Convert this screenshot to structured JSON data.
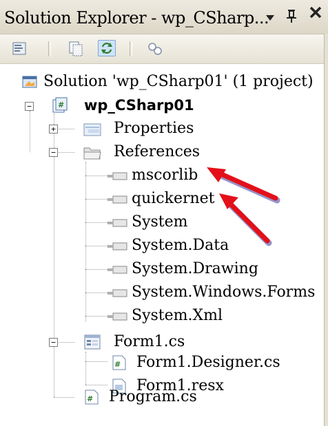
{
  "window": {
    "title": "Solution Explorer - wp_CSharp...",
    "dropdown_glyph": "▾",
    "pin_glyph": "ᐃ",
    "close_glyph": "×"
  },
  "toolbar": {
    "buttons": [
      {
        "icon": "properties-icon"
      },
      {
        "icon": "show-all-files-icon"
      },
      {
        "icon": "refresh-icon"
      },
      {
        "icon": "class-diagram-icon"
      }
    ]
  },
  "tree": {
    "solution": "Solution 'wp_CSharp01' (1 project)",
    "project": "wp_CSharp01",
    "properties": "Properties",
    "references": "References",
    "refs": [
      "mscorlib",
      "quickernet",
      "System",
      "System.Data",
      "System.Drawing",
      "System.Windows.Forms",
      "System.Xml"
    ],
    "form": "Form1.cs",
    "form_children": [
      "Form1.Designer.cs",
      "Form1.resx"
    ],
    "program": "Program.cs"
  },
  "annotations": {
    "arrow_color": "#e3101a"
  }
}
